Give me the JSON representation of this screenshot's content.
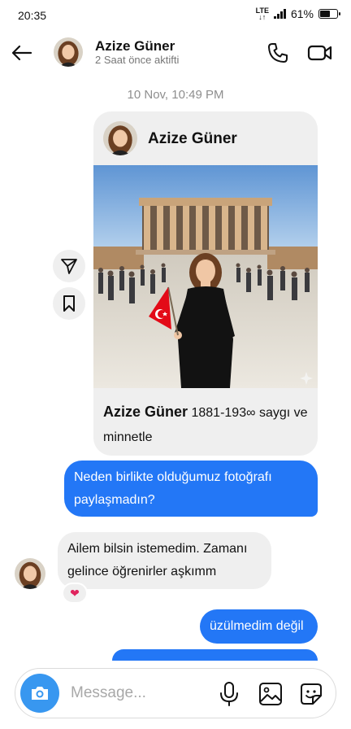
{
  "status_bar": {
    "time": "20:35",
    "network": "LTE",
    "battery": "61%",
    "battery_level": 0.61
  },
  "header": {
    "name": "Azize Güner",
    "status": "2 Saat önce aktifti"
  },
  "timestamp": "10 Nov, 10:49 PM",
  "post": {
    "author": "Azize Güner",
    "caption_author": "Azize Güner",
    "caption_text": " 1881-193∞ saygı ve minnetle"
  },
  "messages": [
    {
      "direction": "outgoing",
      "text": "Neden birlikte olduğumuz fotoğrafı paylaşmadın?"
    },
    {
      "direction": "incoming",
      "text": "Ailem bilsin istemedim. Zamanı gelince öğrenirler aşkımm",
      "reaction": "❤"
    },
    {
      "direction": "outgoing",
      "text": "üzülmedim değil"
    }
  ],
  "composer": {
    "placeholder": "Message..."
  },
  "colors": {
    "accent_blue": "#2377f6",
    "bubble_gray": "#efefef",
    "camera_blue": "#3897f0"
  },
  "icons": [
    "back-arrow-icon",
    "phone-icon",
    "video-call-icon",
    "send-icon",
    "bookmark-icon",
    "camera-icon",
    "microphone-icon",
    "gallery-icon",
    "sticker-icon"
  ]
}
